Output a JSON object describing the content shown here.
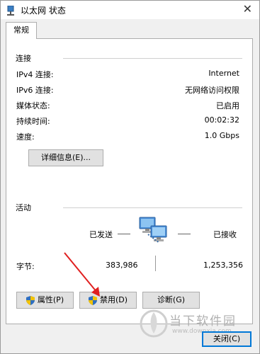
{
  "window": {
    "title": "以太网 状态",
    "close_glyph": "✕"
  },
  "tabs": [
    {
      "label": "常规",
      "active": true
    }
  ],
  "connection": {
    "group_title": "连接",
    "rows": [
      {
        "label": "IPv4 连接:",
        "value": "Internet"
      },
      {
        "label": "IPv6 连接:",
        "value": "无网络访问权限"
      },
      {
        "label": "媒体状态:",
        "value": "已启用"
      },
      {
        "label": "持续时间:",
        "value": "00:02:32"
      },
      {
        "label": "速度:",
        "value": "1.0 Gbps"
      }
    ],
    "details_button": "详细信息(E)..."
  },
  "activity": {
    "group_title": "活动",
    "sent_label": "已发送",
    "received_label": "已接收",
    "bytes_label": "字节:",
    "bytes_sent": "383,986",
    "bytes_received": "1,253,356",
    "network_icon": "network-computers-icon"
  },
  "buttons": {
    "properties": "属性(P)",
    "disable": "禁用(D)",
    "diagnose": "诊断(G)",
    "close": "关闭(C)"
  },
  "watermark": {
    "brand": "当下软件园",
    "url": "www.downxia.com"
  },
  "colors": {
    "accent": "#0078d7",
    "annotation_arrow": "#e02020",
    "window_bg": "#f0f0f0",
    "panel_bg": "#ffffff"
  }
}
